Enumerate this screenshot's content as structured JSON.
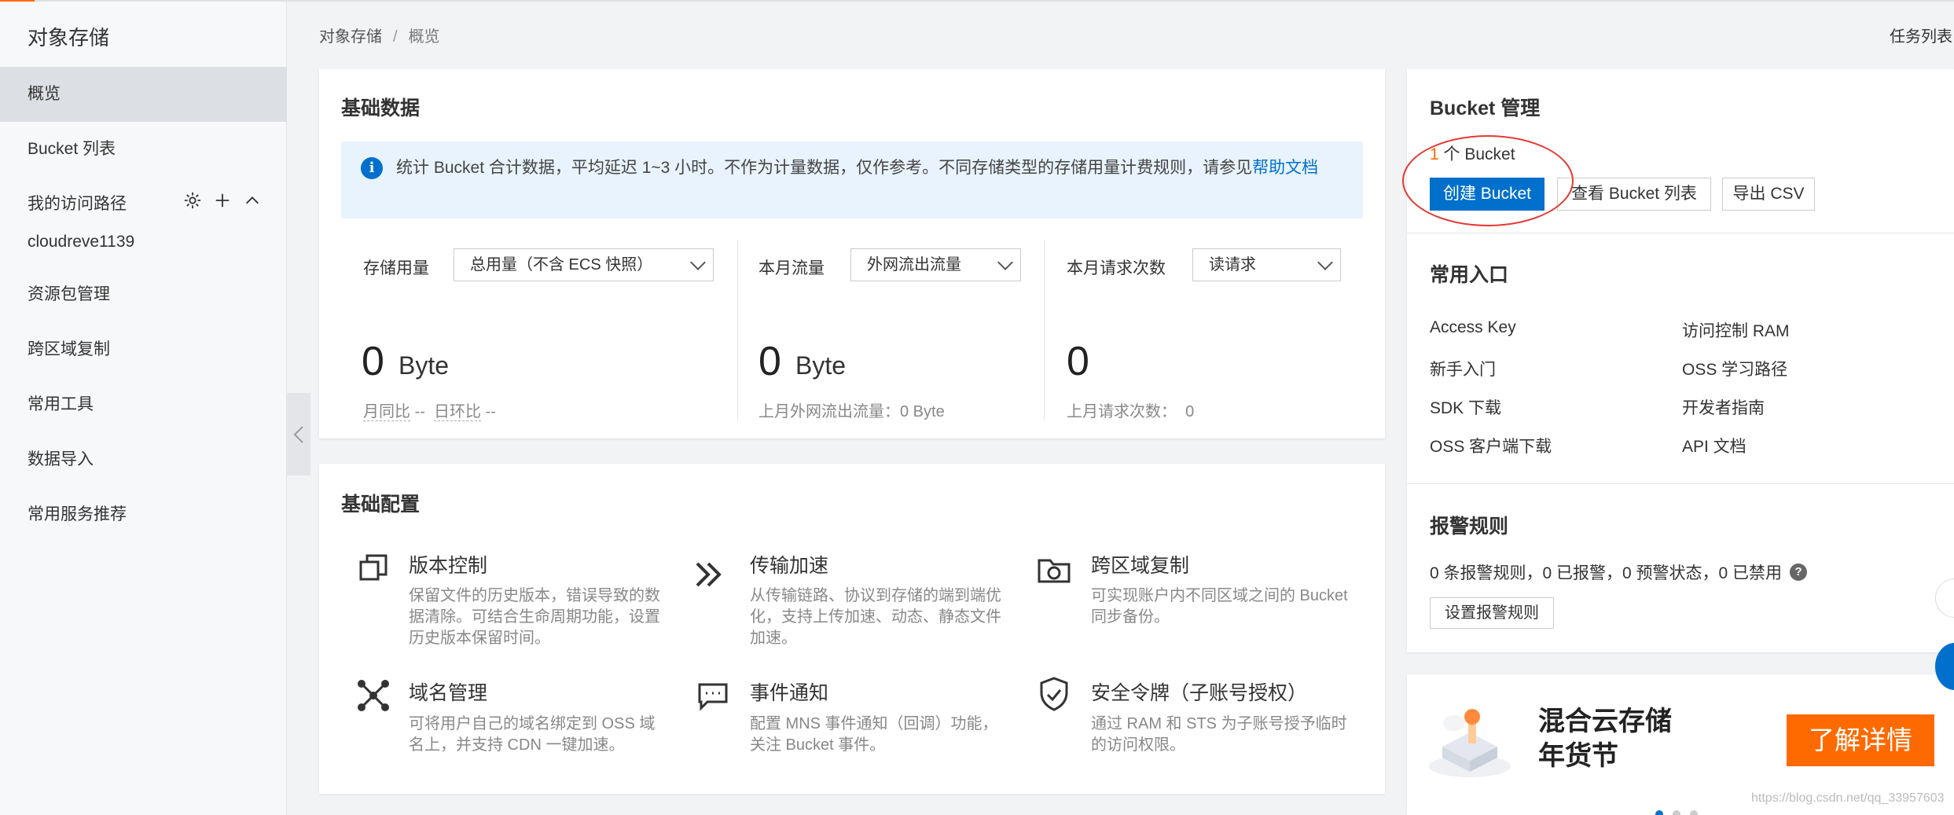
{
  "sidebar": {
    "title": "对象存储",
    "items": [
      {
        "label": "概览"
      },
      {
        "label": "Bucket 列表"
      }
    ],
    "access_path": {
      "label": "我的访问路径",
      "sub_item": "cloudreve1139"
    },
    "items2": [
      {
        "label": "资源包管理"
      },
      {
        "label": "跨区域复制"
      },
      {
        "label": "常用工具"
      },
      {
        "label": "数据导入"
      },
      {
        "label": "常用服务推荐"
      }
    ]
  },
  "breadcrumb": {
    "root": "对象存储",
    "sep": "/",
    "current": "概览"
  },
  "header": {
    "task_list": "任务列表"
  },
  "basic_data": {
    "title": "基础数据",
    "notice": "统计 Bucket 合计数据，平均延迟 1~3 小时。不作为计量数据，仅作参考。不同存储类型的存储用量计费规则，请参见",
    "notice_link": "帮助文档",
    "storage": {
      "label": "存储用量",
      "select": "总用量（不含 ECS 快照）",
      "value": "0",
      "unit": "Byte",
      "mom_label": "月同比",
      "mom_value": "--",
      "dod_label": "日环比",
      "dod_value": "--"
    },
    "traffic": {
      "label": "本月流量",
      "select": "外网流出流量",
      "value": "0",
      "unit": "Byte",
      "last_month": "上月外网流出流量：0 Byte"
    },
    "requests": {
      "label": "本月请求次数",
      "select": "读请求",
      "value": "0",
      "last_month_label": "上月请求次数：",
      "last_month_value": "0"
    }
  },
  "basic_config": {
    "title": "基础配置",
    "items": [
      {
        "title": "版本控制",
        "desc": "保留文件的历史版本，错误导致的数据清除。可结合生命周期功能，设置历史版本保留时间。",
        "icon": "copy-icon"
      },
      {
        "title": "传输加速",
        "desc": "从传输链路、协议到存储的端到端优化，支持上传加速、动态、静态文件加速。",
        "icon": "double-chevron-icon"
      },
      {
        "title": "跨区域复制",
        "desc": "可实现账户内不同区域之间的 Bucket 同步备份。",
        "icon": "cloud-sync-icon"
      },
      {
        "title": "域名管理",
        "desc": "可将用户自己的域名绑定到 OSS 域名上，并支持 CDN 一键加速。",
        "icon": "network-icon"
      },
      {
        "title": "事件通知",
        "desc": "配置 MNS 事件通知（回调）功能，关注 Bucket 事件。",
        "icon": "message-icon"
      },
      {
        "title": "安全令牌（子账号授权）",
        "desc": "通过 RAM 和 STS 为子账号授予临时的访问权限。",
        "icon": "shield-icon"
      }
    ]
  },
  "bucket_mgmt": {
    "title": "Bucket 管理",
    "count": "1",
    "count_suffix": "个 Bucket",
    "create_btn": "创建 Bucket",
    "list_btn": "查看 Bucket 列表",
    "export_btn": "导出 CSV"
  },
  "common_entry": {
    "title": "常用入口",
    "links": [
      "Access Key",
      "访问控制 RAM",
      "新手入门",
      "OSS 学习路径",
      "SDK 下载",
      "开发者指南",
      "OSS 客户端下载",
      "API 文档"
    ]
  },
  "alarm": {
    "title": "报警规则",
    "text": "0 条报警规则，0 已报警，0 预警状态，0 已禁用",
    "btn": "设置报警规则"
  },
  "promo": {
    "line1": "混合云存储",
    "line2": "年货节",
    "btn": "了解详情"
  },
  "watermark": "https://blog.csdn.net/qq_33957603",
  "colors": {
    "primary": "#0070cc",
    "accent": "#ff6a00",
    "annotation": "#e53935"
  }
}
